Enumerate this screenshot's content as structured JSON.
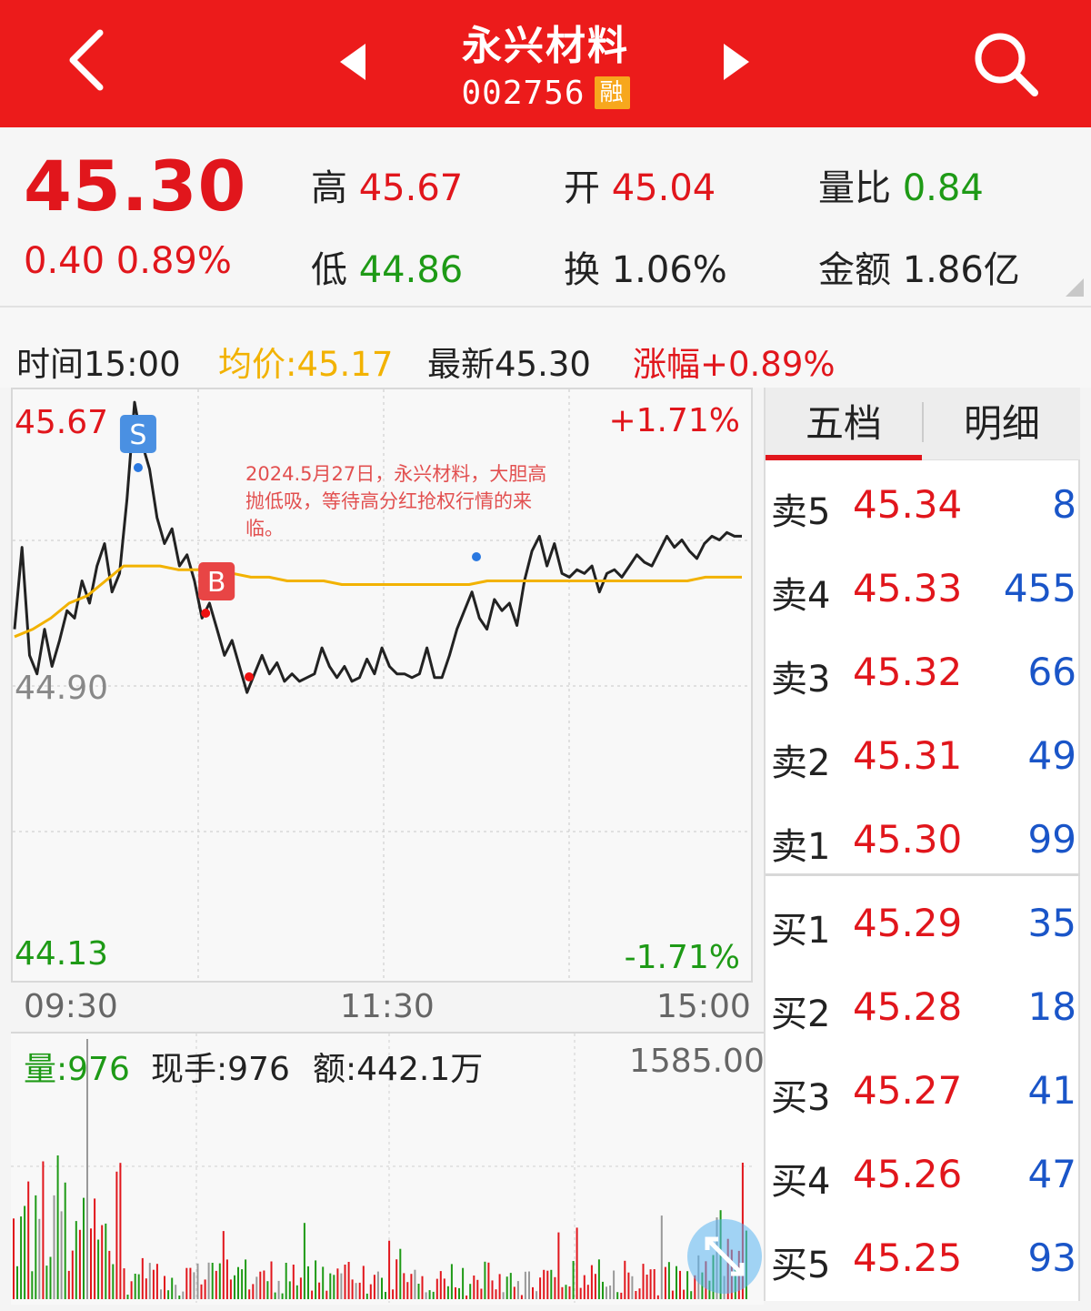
{
  "header": {
    "title": "永兴材料",
    "code": "002756",
    "badge": "融"
  },
  "quote": {
    "price": "45.30",
    "change": "0.40",
    "change_pct": "0.89%",
    "high_label": "高",
    "high": "45.67",
    "low_label": "低",
    "low": "44.86",
    "open_label": "开",
    "open": "45.04",
    "turnover_label": "换",
    "turnover": "1.06%",
    "vol_ratio_label": "量比",
    "vol_ratio": "0.84",
    "amount_label": "金额",
    "amount": "1.86亿"
  },
  "info": {
    "time": "时间15:00",
    "avg": "均价:45.17",
    "latest": "最新45.30",
    "change": "涨幅+0.89%"
  },
  "chart_data": {
    "type": "line",
    "y_top": "45.67",
    "y_mid": "44.90",
    "y_bottom": "44.13",
    "pct_top": "+1.71%",
    "pct_bottom": "-1.71%",
    "x_ticks": [
      "09:30",
      "11:30",
      "15:00"
    ],
    "ylim": [
      44.13,
      45.67
    ],
    "annotation": "2024.5月27日，永兴材料，大胆高抛低吸，等待高分红抢权行情的来临。",
    "markers": [
      {
        "label": "S"
      },
      {
        "label": "B"
      }
    ],
    "series": [
      {
        "values": [
          45.05,
          45.27,
          44.98,
          44.93,
          45.05,
          44.95,
          45.02,
          45.1,
          45.08,
          45.18,
          45.12,
          45.22,
          45.28,
          45.15,
          45.2,
          45.4,
          45.66,
          45.55,
          45.48,
          45.35,
          45.28,
          45.32,
          45.22,
          45.25,
          45.18,
          45.08,
          45.12,
          45.05,
          44.98,
          45.02,
          44.95,
          44.88,
          44.93,
          44.98,
          44.93,
          44.96,
          44.91,
          44.93,
          44.91,
          44.92,
          44.93,
          45.0,
          44.95,
          44.92,
          44.95,
          44.91,
          44.92,
          44.97,
          44.93,
          45.0,
          44.95,
          44.93,
          44.93,
          44.92,
          44.93,
          45.0,
          44.92,
          44.92,
          44.98,
          45.05,
          45.1,
          45.15,
          45.08,
          45.05,
          45.13,
          45.1,
          45.12,
          45.06,
          45.18,
          45.26,
          45.3,
          45.22,
          45.28,
          45.2,
          45.19,
          45.21,
          45.2,
          45.22,
          45.15,
          45.2,
          45.21,
          45.19,
          45.22,
          45.25,
          45.23,
          45.22,
          45.26,
          45.3,
          45.27,
          45.29,
          45.26,
          45.24,
          45.28,
          45.3,
          45.29,
          45.31,
          45.3,
          45.3
        ],
        "color": "#222222"
      },
      {
        "values": [
          45.03,
          45.05,
          45.08,
          45.12,
          45.14,
          45.18,
          45.22,
          45.22,
          45.22,
          45.21,
          45.21,
          45.21,
          45.2,
          45.19,
          45.19,
          45.18,
          45.18,
          45.18,
          45.17,
          45.17,
          45.17,
          45.17,
          45.17,
          45.17,
          45.17,
          45.17,
          45.18,
          45.18,
          45.18,
          45.18,
          45.18,
          45.18,
          45.18,
          45.18,
          45.18,
          45.18,
          45.18,
          45.18,
          45.19,
          45.19,
          45.19
        ],
        "color": "#f2b200"
      }
    ]
  },
  "volume": {
    "label": "量:976",
    "hand": "现手:976",
    "amount": "额:442.1万",
    "max": "1585.00"
  },
  "book": {
    "tabs": [
      "五档",
      "明细"
    ],
    "asks": [
      {
        "label": "卖5",
        "price": "45.34",
        "vol": "8"
      },
      {
        "label": "卖4",
        "price": "45.33",
        "vol": "455"
      },
      {
        "label": "卖3",
        "price": "45.32",
        "vol": "66"
      },
      {
        "label": "卖2",
        "price": "45.31",
        "vol": "49"
      },
      {
        "label": "卖1",
        "price": "45.30",
        "vol": "99"
      }
    ],
    "bids": [
      {
        "label": "买1",
        "price": "45.29",
        "vol": "35"
      },
      {
        "label": "买2",
        "price": "45.28",
        "vol": "18"
      },
      {
        "label": "买3",
        "price": "45.27",
        "vol": "41"
      },
      {
        "label": "买4",
        "price": "45.26",
        "vol": "47"
      },
      {
        "label": "买5",
        "price": "45.25",
        "vol": "93"
      }
    ]
  },
  "colors": {
    "up": "#e1161c",
    "down": "#1e9a16",
    "brand": "#ec1b1b",
    "avg": "#f2b200",
    "vol": "#1a55c8"
  }
}
